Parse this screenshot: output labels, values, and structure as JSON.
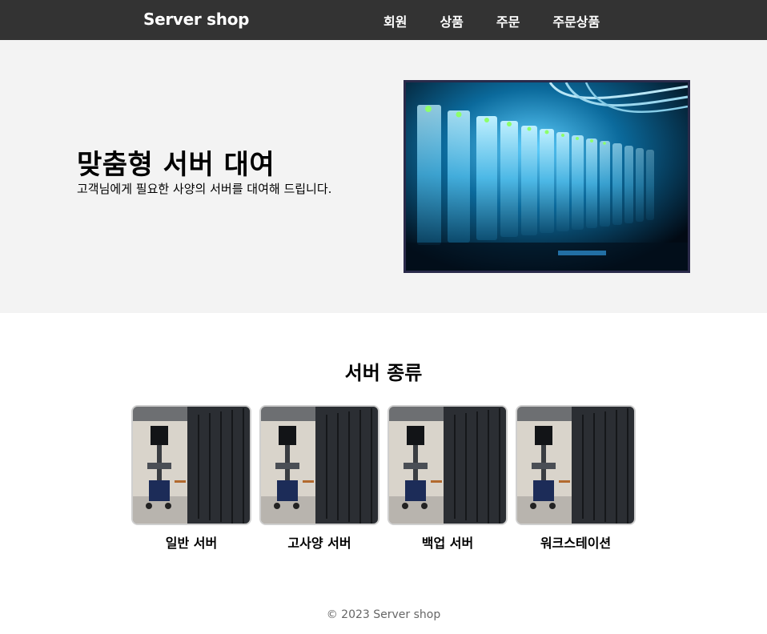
{
  "nav": {
    "brand": "Server shop",
    "links": [
      {
        "label": "회원"
      },
      {
        "label": "상품"
      },
      {
        "label": "주문"
      },
      {
        "label": "주문상품"
      }
    ]
  },
  "hero": {
    "title": "맞춤형 서버 대여",
    "subtitle": "고객님에게 필요한 사양의 서버를 대여해 드립니다.",
    "image_icon": "server-rack-photo"
  },
  "section": {
    "title": "서버 종류",
    "cards": [
      {
        "label": "일반 서버",
        "image_icon": "datacenter-photo"
      },
      {
        "label": "고사양 서버",
        "image_icon": "datacenter-photo"
      },
      {
        "label": "백업 서버",
        "image_icon": "datacenter-photo"
      },
      {
        "label": "워크스테이션",
        "image_icon": "datacenter-photo"
      }
    ]
  },
  "footer": {
    "text": "© 2023 Server shop"
  },
  "colors": {
    "navbar_bg": "#333333",
    "hero_bg": "#f3f3f3",
    "hero_image_border": "#2a2a4a",
    "card_border": "#cfcfcf",
    "footer_text": "#666666"
  }
}
